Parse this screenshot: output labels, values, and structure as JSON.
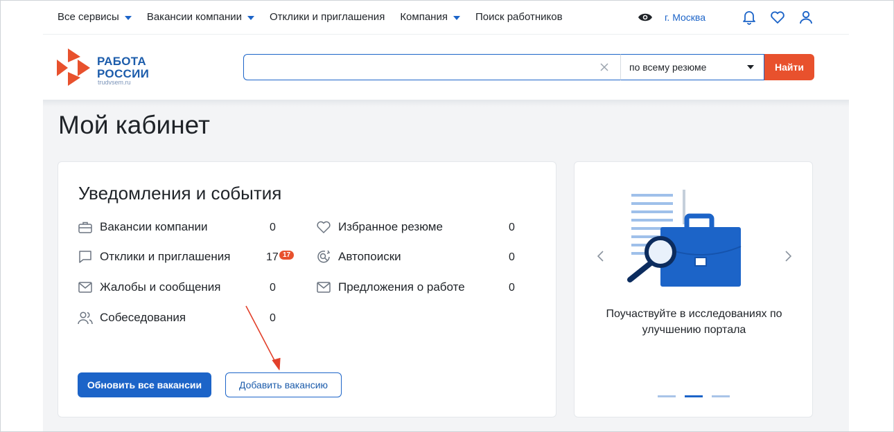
{
  "topnav": {
    "items": [
      {
        "label": "Все сервисы",
        "dropdown": true
      },
      {
        "label": "Вакансии компании",
        "dropdown": true
      },
      {
        "label": "Отклики и приглашения",
        "dropdown": false
      },
      {
        "label": "Компания",
        "dropdown": true
      },
      {
        "label": "Поиск работников",
        "dropdown": false
      }
    ],
    "city": "г. Москва",
    "icons": [
      "eye-icon",
      "bell-icon",
      "heart-icon",
      "user-icon"
    ]
  },
  "logo": {
    "line1": "РАБОТА",
    "line2": "РОССИИ",
    "sub": "trudvsem.ru"
  },
  "search": {
    "value": "",
    "placeholder": "",
    "scope": "по всему резюме",
    "button": "Найти"
  },
  "page": {
    "title": "Мой кабинет"
  },
  "notifications": {
    "title": "Уведомления и события",
    "left": [
      {
        "icon": "briefcase-icon",
        "label": "Вакансии компании",
        "count": "0"
      },
      {
        "icon": "chat-icon",
        "label": "Отклики и приглашения",
        "count": "17",
        "badge": "17"
      },
      {
        "icon": "mail-icon",
        "label": "Жалобы и сообщения",
        "count": "0"
      },
      {
        "icon": "users-icon",
        "label": "Собеседования",
        "count": "0"
      }
    ],
    "right": [
      {
        "icon": "heart-icon",
        "label": "Избранное резюме",
        "count": "0"
      },
      {
        "icon": "autosearch-icon",
        "label": "Автопоиски",
        "count": "0"
      },
      {
        "icon": "mail-icon",
        "label": "Предложения о работе",
        "count": "0"
      }
    ],
    "buttons": {
      "update": "Обновить все вакансии",
      "add": "Добавить вакансию"
    }
  },
  "promo": {
    "line1": "Поучаствуйте в исследованиях по",
    "line2": "улучшению портала",
    "slides": 3,
    "active_slide": 2
  },
  "colors": {
    "accent": "#1c64c8",
    "brand_orange": "#e8512d",
    "background": "#f3f4f6",
    "annotation_arrow": "#e2402b"
  }
}
